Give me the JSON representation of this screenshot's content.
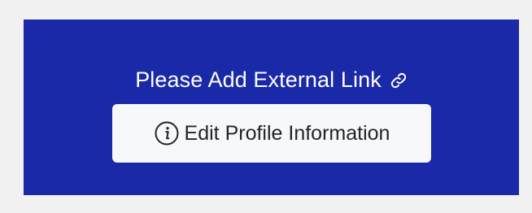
{
  "banner": {
    "message": "Please Add External Link",
    "link_icon": "link-icon",
    "background_color": "#1a29a8",
    "text_color": "#ffffff"
  },
  "edit_button": {
    "label": "Edit Profile Information",
    "icon": "info-circle-icon",
    "background_color": "#f7f8fa",
    "text_color": "#212529"
  }
}
